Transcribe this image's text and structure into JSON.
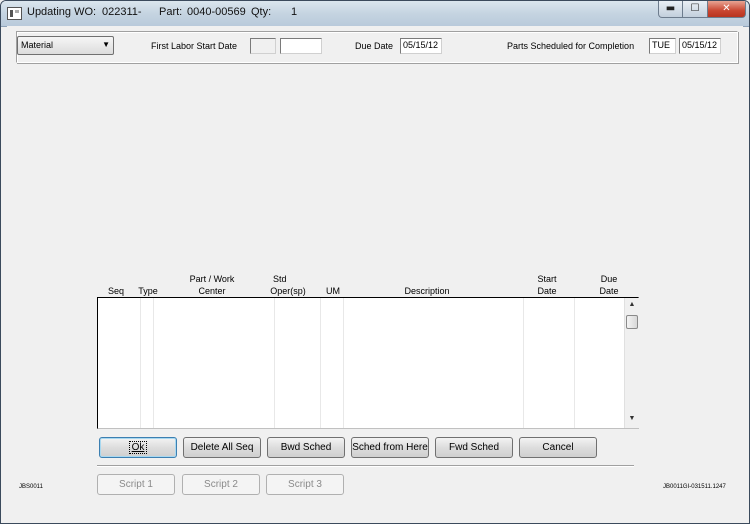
{
  "window": {
    "title_prefix": "Updating WO:",
    "wo_number": "022311-",
    "part_label": "Part:",
    "part_number": "0040-00569",
    "qty_label": "Qty:",
    "qty_value": "1",
    "minimize": "▬",
    "maximize": "☐",
    "close": "✕"
  },
  "header": {
    "material_select": "Material",
    "first_labor_label": "First Labor Start Date",
    "first_labor_day": "",
    "first_labor_date": "",
    "due_date_label": "Due Date",
    "due_date_value": "05/15/12",
    "parts_sched_label": "Parts Scheduled for Completion",
    "parts_sched_day": "TUE",
    "parts_sched_date": "05/15/12"
  },
  "grid": {
    "columns": {
      "seq": "Seq",
      "type": "Type",
      "part_line1": "Part / Work",
      "part_line2": "Center",
      "std_line1": "Std",
      "std_line2": "Oper(sp)",
      "um": "UM",
      "description": "Description",
      "start_line1": "Start",
      "start_line2": "Date",
      "due_line1": "Due",
      "due_line2": "Date"
    },
    "rows": []
  },
  "buttons": {
    "ok": "Ok",
    "delete_all_seq": "Delete All Seq",
    "bwd_sched": "Bwd Sched",
    "sched_from_here": "Sched from Here",
    "fwd_sched": "Fwd Sched",
    "cancel": "Cancel",
    "script1": "Script 1",
    "script2": "Script 2",
    "script3": "Script 3"
  },
  "footer": {
    "form_id_left": "JBS0011",
    "form_id_right": "JB0011GI-031511.1247"
  }
}
